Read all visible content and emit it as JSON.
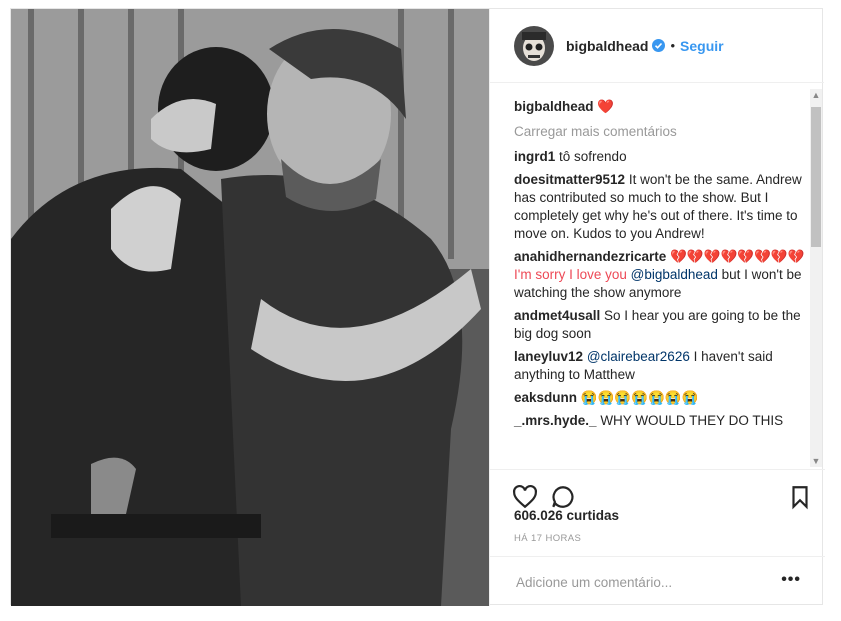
{
  "post": {
    "author": "bigbaldhead",
    "verified_badge": "verified-badge-icon",
    "follow_separator": "•",
    "follow_label": "Seguir",
    "caption_text": "❤️",
    "load_more": "Carregar mais comentários",
    "comments": [
      {
        "user": "ingrd1",
        "text": "tô sofrendo"
      },
      {
        "user": "doesitmatter9512",
        "text": "It won't be the same. Andrew has contributed so much to the show. But I completely get why he's out of there. It's time to move on. Kudos to you Andrew!"
      },
      {
        "user": "anahidhernandezricarte",
        "text_before": "💔💔💔💔💔💔💔💔 I'm sorry I love you ",
        "mention": "@bigbaldhead",
        "text_after": " but I won't be watching the show anymore"
      },
      {
        "user": "andmet4usall",
        "text": "So I hear you are going to be the big dog soon"
      },
      {
        "user": "laneyluv12",
        "mention": "@clairebear2626",
        "text_after": " I haven't said anything to Matthew"
      },
      {
        "user": "eaksdunn",
        "text": "😭😭😭😭😭😭😭"
      },
      {
        "user": "_.mrs.hyde._",
        "text": "WHY WOULD THEY DO THIS"
      }
    ],
    "likes": "606.026 curtidas",
    "timestamp": "HÁ 17 HORAS",
    "comment_placeholder": "Adicione um comentário...",
    "more_options": "•••",
    "icons": [
      "heart-icon",
      "comment-icon",
      "bookmark-icon"
    ],
    "colors": {
      "link": "#3897f0",
      "heart": "#ed4956",
      "text": "#262626",
      "muted": "#999999"
    }
  }
}
